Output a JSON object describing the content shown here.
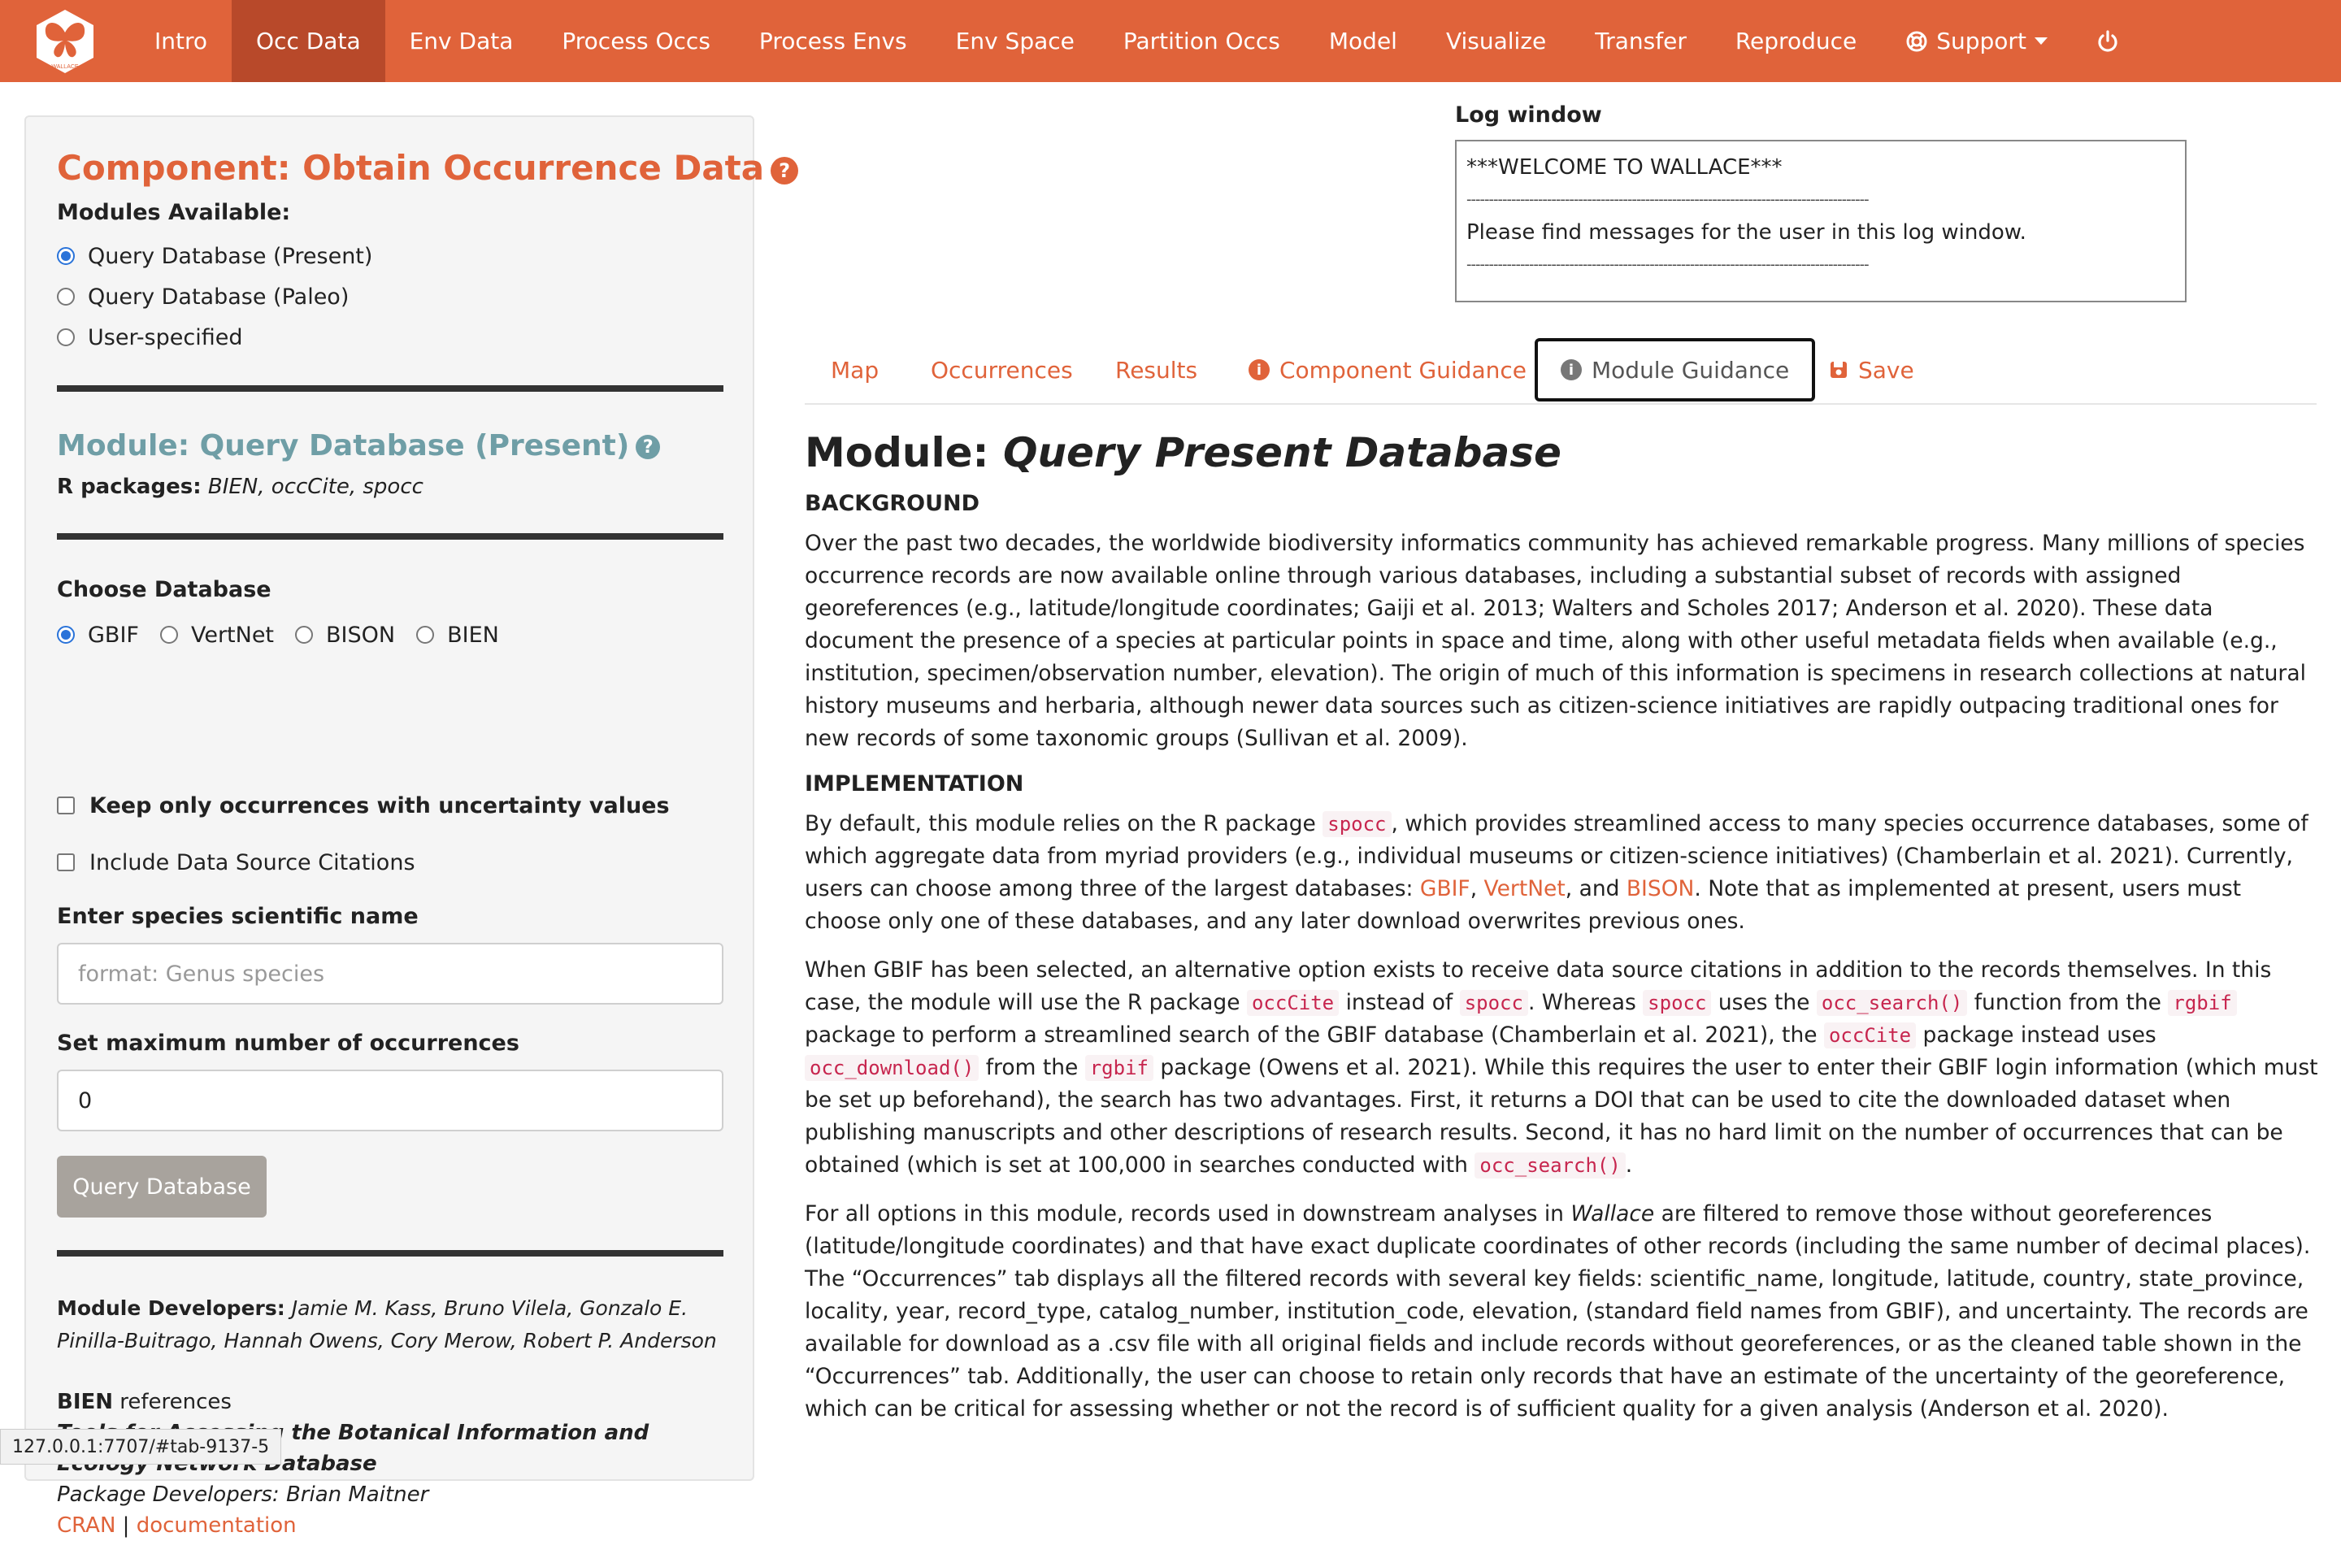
{
  "nav": {
    "logo_text": "WALLACE",
    "items": [
      "Intro",
      "Occ Data",
      "Env Data",
      "Process Occs",
      "Process Envs",
      "Env Space",
      "Partition Occs",
      "Model",
      "Visualize",
      "Transfer",
      "Reproduce"
    ],
    "active_index": 1,
    "support_label": "Support",
    "brand_color": "#e0633a"
  },
  "sidebar": {
    "component_title": "Component: Obtain Occurrence Data",
    "modules_available_label": "Modules Available:",
    "modules": [
      "Query Database (Present)",
      "Query Database (Paleo)",
      "User-specified"
    ],
    "selected_module_index": 0,
    "module_title": "Module: Query Database (Present)",
    "r_packages_label": "R packages:",
    "r_packages": "BIEN, occCite, spocc",
    "choose_db_label": "Choose Database",
    "databases": [
      "GBIF",
      "VertNet",
      "BISON",
      "BIEN"
    ],
    "selected_db_index": 0,
    "uncertainty_checkbox": "Keep only occurrences with uncertainty values",
    "citations_checkbox": "Include Data Source Citations",
    "species_label": "Enter species scientific name",
    "species_placeholder": "format: Genus species",
    "max_occ_label": "Set maximum number of occurrences",
    "max_occ_value": "0",
    "query_button": "Query Database",
    "developers_label": "Module Developers:",
    "developers": "Jamie M. Kass, Bruno Vilela, Gonzalo E. Pinilla-Buitrago, Hannah Owens, Cory Merow, Robert P. Anderson",
    "bien_ref_label_bold": "BIEN",
    "bien_ref_label_rest": " references",
    "bien_ref_title": "Tools for Accessing the Botanical Information and Ecology Network Database",
    "bien_pkg_devs": "Package Developers: Brian Maitner",
    "cran_link": "CRAN",
    "sep": "|",
    "doc_link": "documentation"
  },
  "log": {
    "title": "Log window",
    "line1": "***WELCOME TO WALLACE***",
    "dashes": "------------------------------------------------------------------------------------------",
    "line2": "Please find messages for the user in this log window."
  },
  "tabs": {
    "map": "Map",
    "occurrences": "Occurrences",
    "results": "Results",
    "component_guidance": "Component Guidance",
    "module_guidance": "Module Guidance",
    "save": "Save"
  },
  "content": {
    "title_prefix": "Module: ",
    "title_italic": "Query Present Database",
    "background_heading": "BACKGROUND",
    "background_text": "Over the past two decades, the worldwide biodiversity informatics community has achieved remarkable progress. Many millions of species occurrence records are now available online through various databases, including a substantial subset of records with assigned georeferences (e.g., latitude/longitude coordinates; Gaiji et al. 2013; Walters and Scholes 2017; Anderson et al. 2020). These data document the presence of a species at particular points in space and time, along with other useful metadata fields when available (e.g., institution, specimen/observation number, elevation). The origin of much of this information is specimens in research collections at natural history museums and herbaria, although newer data sources such as citizen-science initiatives are rapidly outpacing traditional ones for new records of some taxonomic groups (Sullivan et al. 2009).",
    "implementation_heading": "IMPLEMENTATION",
    "p2_a": "By default, this module relies on the R package ",
    "p2_code": "spocc",
    "p2_b": ", which provides streamlined access to many species occurrence databases, some of which aggregate data from myriad providers (e.g., individual museums or citizen-science initiatives) (Chamberlain et al. 2021). Currently, users can choose among three of the largest databases: ",
    "p2_link1": "GBIF",
    "p2_c": ", ",
    "p2_link2": "VertNet",
    "p2_d": ", and ",
    "p2_link3": "BISON",
    "p2_e": ". Note that as implemented at present, users must choose only one of these databases, and any later download overwrites previous ones.",
    "p3_a": "When GBIF has been selected, an alternative option exists to receive data source citations in addition to the records themselves. In this case, the module will use the R package ",
    "p3_code1": "occCite",
    "p3_b": " instead of ",
    "p3_code2": "spocc",
    "p3_c": ". Whereas ",
    "p3_code3": "spocc",
    "p3_d": " uses the ",
    "p3_code4": "occ_search()",
    "p3_e": " function from the ",
    "p3_code5": "rgbif",
    "p3_f": " package to perform a streamlined search of the GBIF database (Chamberlain et al. 2021), the ",
    "p3_code6": "occCite",
    "p3_g": " package instead uses ",
    "p3_code7": "occ_download()",
    "p3_h": " from the ",
    "p3_code8": "rgbif",
    "p3_i": " package (Owens et al. 2021). While this requires the user to enter their GBIF login information (which must be set up beforehand), the search has two advantages. First, it returns a DOI that can be used to cite the downloaded dataset when publishing manuscripts and other descriptions of research results. Second, it has no hard limit on the number of occurrences that can be obtained (which is set at 100,000 in searches conducted with ",
    "p3_code9": "occ_search()",
    "p3_j": ".",
    "p4_a": "For all options in this module, records used in downstream analyses in ",
    "p4_italic": "Wallace",
    "p4_b": " are filtered to remove those without georeferences (latitude/longitude coordinates) and that have exact duplicate coordinates of other records (including the same number of decimal places). The “Occurrences” tab displays all the filtered records with several key fields: scientific_name, longitude, latitude, country, state_province, locality, year, record_type, catalog_number, institution_code, elevation, (standard field names from GBIF), and uncertainty. The records are available for download as a .csv file with all original fields and include records without georeferences, or as the cleaned table shown in the “Occurrences” tab. Additionally, the user can choose to retain only records that have an estimate of the uncertainty of the georeference, which can be critical for assessing whether or not the record is of sufficient quality for a given analysis (Anderson et al. 2020)."
  },
  "status_url": "127.0.0.1:7707/#tab-9137-5"
}
